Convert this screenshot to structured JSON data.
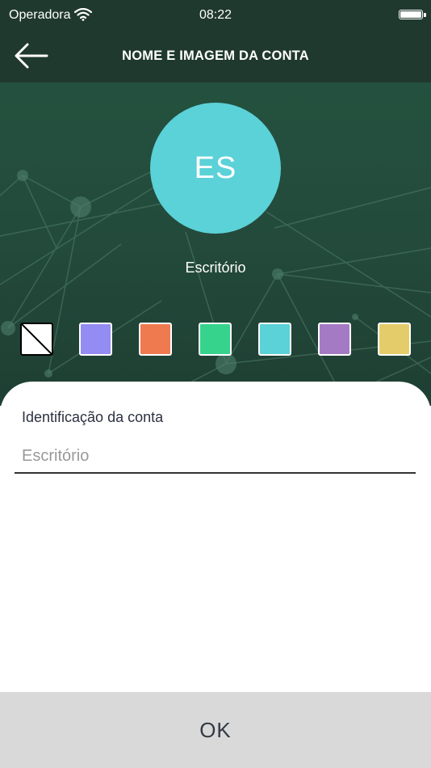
{
  "status_bar": {
    "carrier": "Operadora",
    "time": "08:22"
  },
  "nav": {
    "title": "NOME E IMAGEM DA CONTA"
  },
  "avatar": {
    "initials": "ES",
    "color": "#5bd1d8"
  },
  "account_name": "Escritório",
  "color_swatches": [
    {
      "name": "none",
      "color": "#ffffff"
    },
    {
      "name": "purple-blue",
      "color": "#938cf2"
    },
    {
      "name": "orange",
      "color": "#ef7a50"
    },
    {
      "name": "green",
      "color": "#35d38c"
    },
    {
      "name": "cyan",
      "color": "#5bd1d8"
    },
    {
      "name": "purple",
      "color": "#a57ac4"
    },
    {
      "name": "yellow",
      "color": "#e5cc6a"
    }
  ],
  "form": {
    "label": "Identificação da conta",
    "placeholder": "Escritório",
    "value": ""
  },
  "ok_button": {
    "label": "OK"
  },
  "colors": {
    "header_bg": "#20392f",
    "button_bg": "#d9d9d9"
  }
}
